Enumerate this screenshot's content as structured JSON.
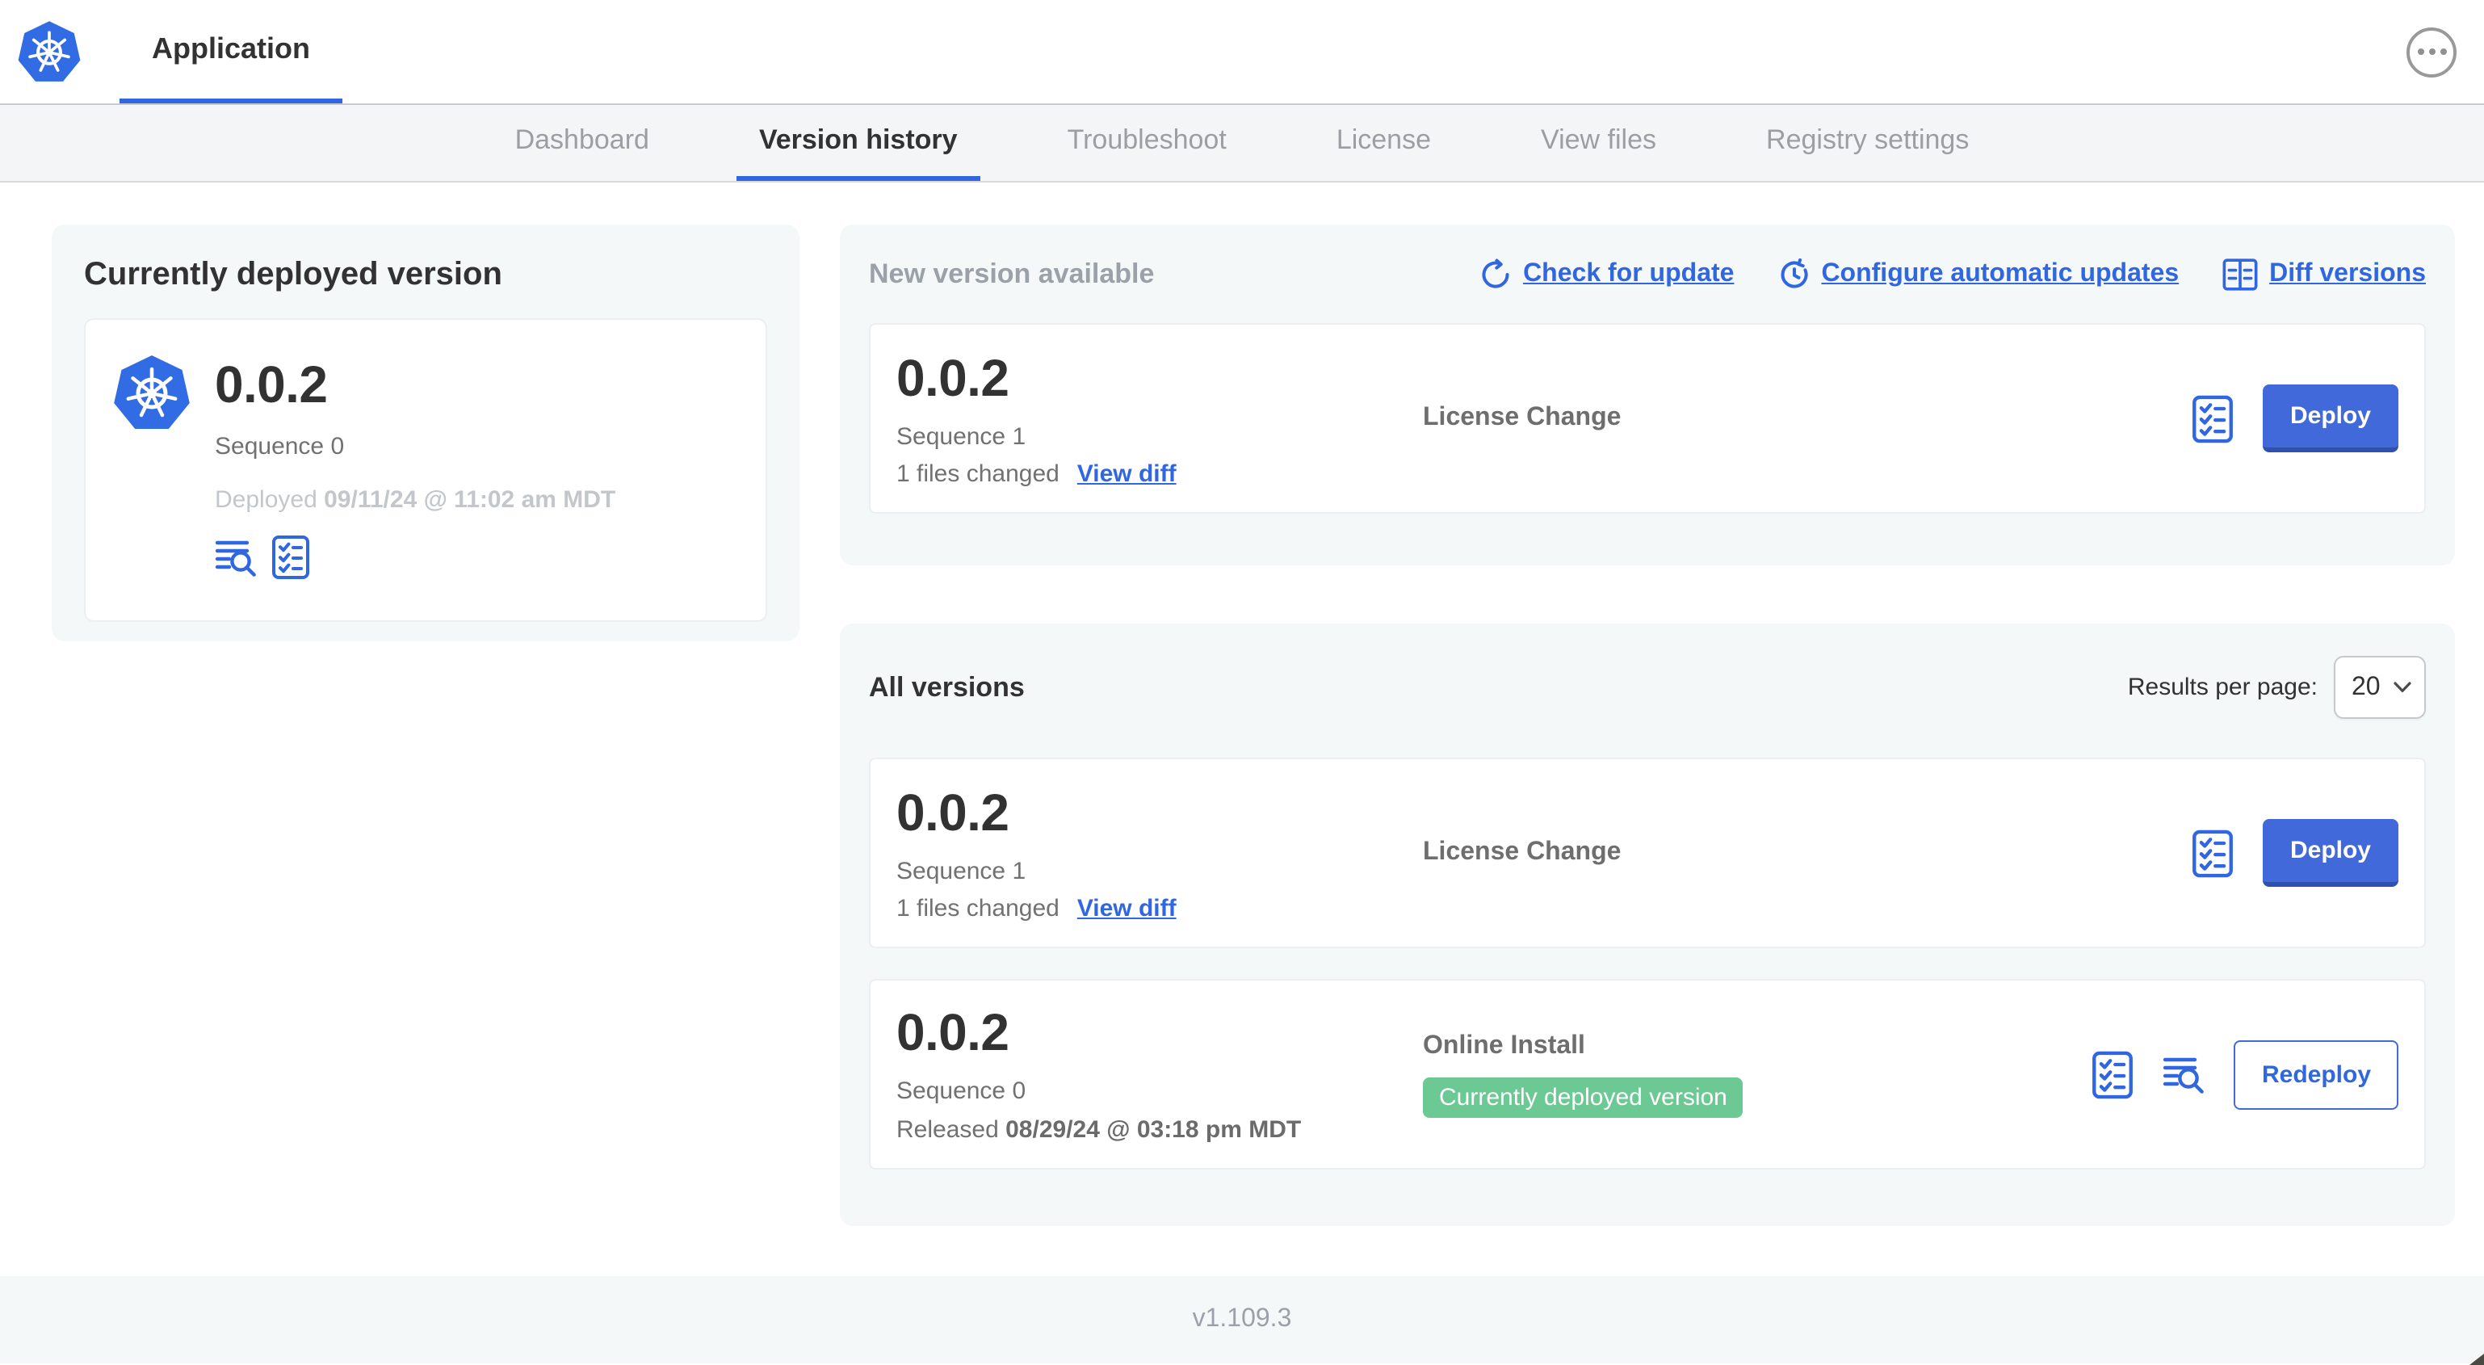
{
  "colors": {
    "link_blue": "#3066e0",
    "button_blue": "#4169d9",
    "button_blue_shadow": "#2e51b0",
    "badge_green": "#6cc994",
    "kubernetes_blue": "#326ce5",
    "panel_gray": "#f5f8f9",
    "text_dark": "#323232",
    "text_muted": "#717171",
    "text_faint": "#c3c7cb"
  },
  "header": {
    "app_title": "Application"
  },
  "nav": {
    "tabs": [
      {
        "label": "Dashboard",
        "active": false
      },
      {
        "label": "Version history",
        "active": true
      },
      {
        "label": "Troubleshoot",
        "active": false
      },
      {
        "label": "License",
        "active": false
      },
      {
        "label": "View files",
        "active": false
      },
      {
        "label": "Registry settings",
        "active": false
      }
    ]
  },
  "current": {
    "title": "Currently deployed version",
    "version": "0.0.2",
    "sequence": "Sequence 0",
    "deployed_prefix": "Deployed",
    "deployed_date": "09/11/24 @ 11:02 am MDT"
  },
  "newver": {
    "title": "New version available",
    "links": [
      {
        "label": "Check for update",
        "icon": "refresh-icon"
      },
      {
        "label": "Configure automatic updates",
        "icon": "clock-arrow-icon"
      },
      {
        "label": "Diff versions",
        "icon": "diff-icon"
      }
    ],
    "card": {
      "version": "0.0.2",
      "sequence": "Sequence 1",
      "files_changed": "1 files changed",
      "view_diff_label": "View diff",
      "source": "License Change",
      "action_label": "Deploy"
    }
  },
  "allver": {
    "title": "All versions",
    "results_per_page_label": "Results per page:",
    "results_per_page_value": "20",
    "rows": [
      {
        "version": "0.0.2",
        "sequence": "Sequence 1",
        "files_changed": "1 files changed",
        "view_diff_label": "View diff",
        "source": "License Change",
        "action_label": "Deploy"
      },
      {
        "version": "0.0.2",
        "sequence": "Sequence 0",
        "released_prefix": "Released",
        "released_date": "08/29/24 @ 03:18 pm MDT",
        "source": "Online Install",
        "badge": "Currently deployed version",
        "action_label": "Redeploy"
      }
    ]
  },
  "footer": {
    "version": "v1.109.3"
  },
  "icons": {
    "kubernetes-logo-icon": "blue heptagon with white ship wheel",
    "overflow-menu-icon": "three dots in circle",
    "refresh-icon": "circular arrow",
    "clock-arrow-icon": "clock with circular arrow",
    "diff-icon": "split rectangle with line rows",
    "view-logs-icon": "text lines with magnifying glass",
    "preflight-checks-icon": "bordered checklist",
    "chevron-down-icon": "select dropdown chevron"
  }
}
